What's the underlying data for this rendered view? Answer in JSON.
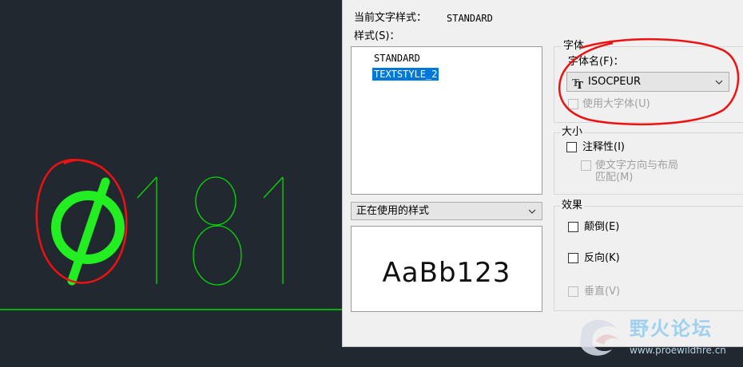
{
  "cad": {
    "drawn_text": "181",
    "symbol": "diameter-symbol"
  },
  "dialog": {
    "current_style_label": "当前文字样式：",
    "current_style_value": "STANDARD",
    "styles_label": "样式(S)：",
    "styles": [
      {
        "label": "STANDARD",
        "selected": false
      },
      {
        "label": "TEXTSTYLE_2",
        "selected": true
      }
    ],
    "filter_combo": "正在使用的样式",
    "preview_text": "AaBb123",
    "font_group": {
      "title": "字体",
      "font_name_label": "字体名(F)：",
      "font_name_value": "ISOCPEUR",
      "big_font_label": "使用大字体(U)"
    },
    "size_group": {
      "title": "大小",
      "annotative_label": "注释性(I)",
      "match_orientation_label_line1": "使文字方向与布局",
      "match_orientation_label_line2": "匹配(M)"
    },
    "effects_group": {
      "title": "效果",
      "upside_down_label": "颠倒(E)",
      "backwards_label": "反向(K)",
      "vertical_label": "垂直(V)"
    }
  },
  "watermark": {
    "title": "野火论坛",
    "url": "www.proewildfire.cn"
  },
  "colors": {
    "cad_background": "#212830",
    "cad_line": "#00dd00",
    "symbol_green": "#22ee22",
    "annotation_red": "#ee1111",
    "selection_blue": "#0078d7",
    "dialog_background": "#f0f0f0"
  }
}
